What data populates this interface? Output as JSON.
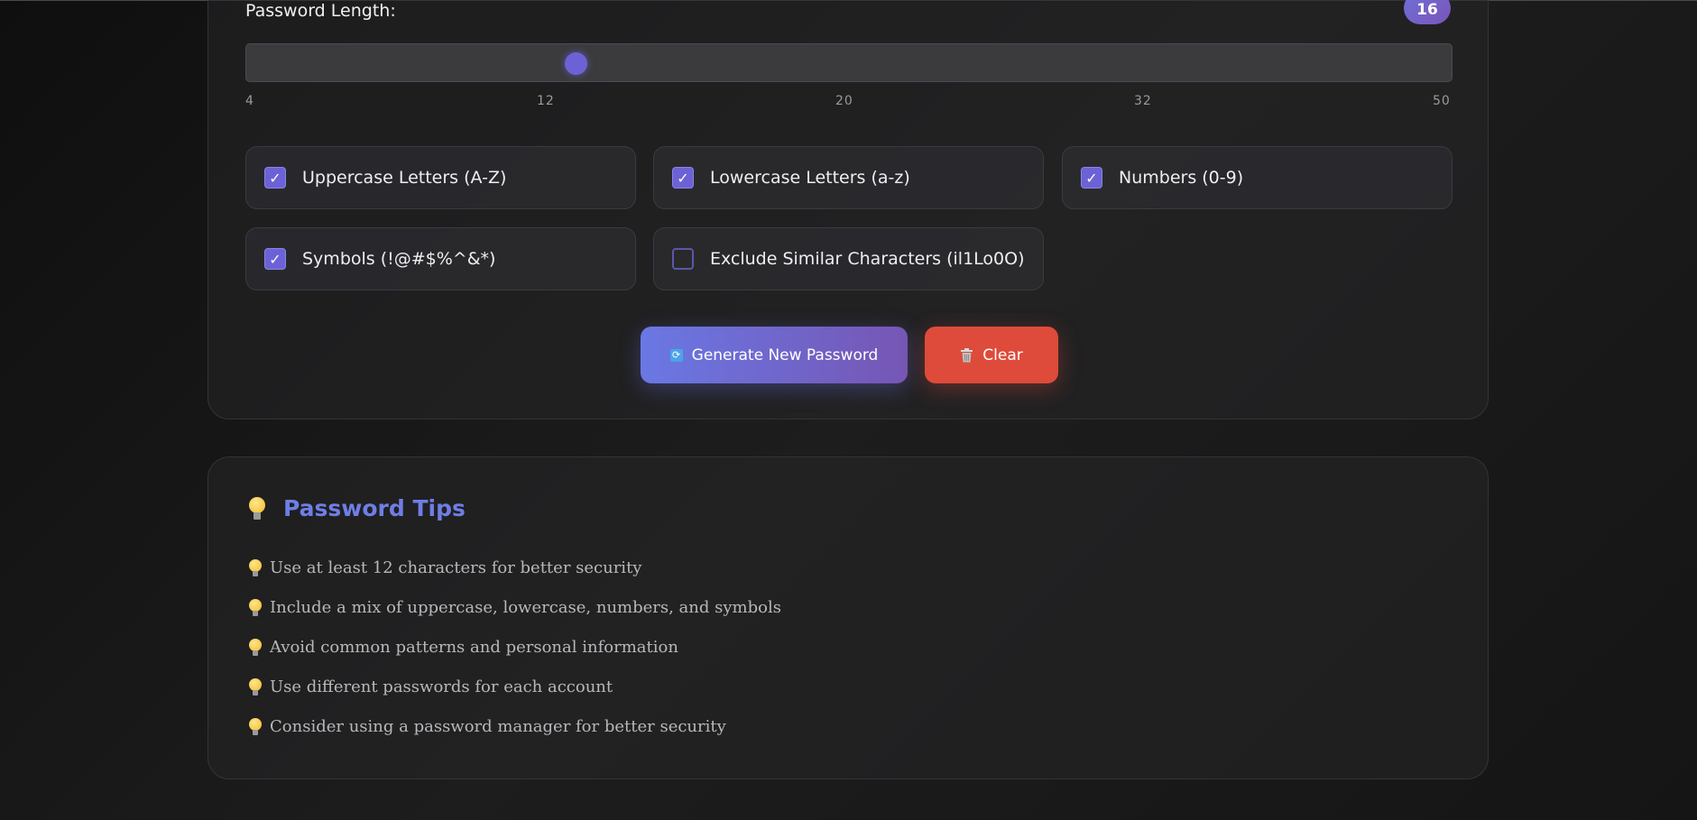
{
  "length": {
    "label": "Password Length:",
    "value": "16",
    "slider_fraction": 0.273,
    "ticks": [
      "4",
      "12",
      "20",
      "32",
      "50"
    ]
  },
  "options": [
    {
      "label": "Uppercase Letters (A-Z)",
      "checked": true,
      "check_glyph": "✓"
    },
    {
      "label": "Lowercase Letters (a-z)",
      "checked": true,
      "check_glyph": "✓"
    },
    {
      "label": "Numbers (0-9)",
      "checked": true,
      "check_glyph": "✓"
    },
    {
      "label": "Symbols (!@#$%^&*)",
      "checked": true,
      "check_glyph": "✓"
    },
    {
      "label": "Exclude Similar Characters (il1Lo0O)",
      "checked": false,
      "check_glyph": ""
    }
  ],
  "buttons": {
    "generate_label": "Generate New Password",
    "generate_icon": "refresh-icon",
    "clear_label": "Clear",
    "clear_icon": "trash-icon"
  },
  "tips": {
    "title": "Password Tips",
    "icon": "lightbulb-icon",
    "items": [
      "Use at least 12 characters for better security",
      "Include a mix of uppercase, lowercase, numbers, and symbols",
      "Avoid common patterns and personal information",
      "Use different passwords for each account",
      "Consider using a password manager for better security"
    ]
  },
  "colors": {
    "accent": "#6c62d6",
    "title_accent": "#6f7ee6",
    "danger": "#de4b3a",
    "background": "#141414"
  }
}
